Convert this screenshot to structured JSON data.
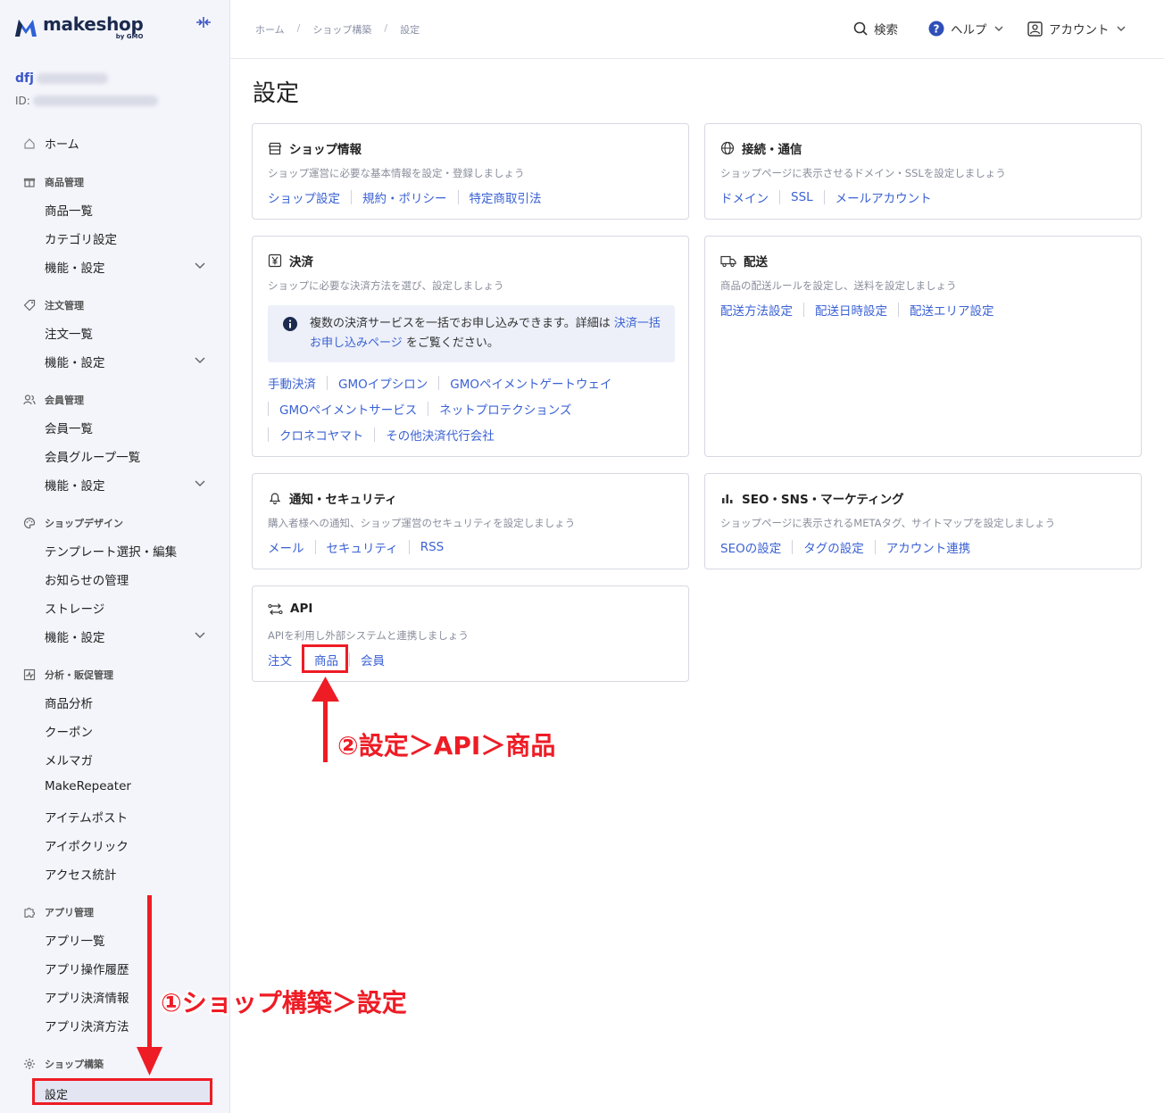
{
  "brand": {
    "name": "makeshop",
    "sub": "by GMO"
  },
  "shop": {
    "name": "dfj",
    "id_label": "ID:"
  },
  "sidebar": {
    "home": "ホーム",
    "products": {
      "title": "商品管理",
      "items": [
        "商品一覧",
        "カテゴリ設定",
        "機能・設定"
      ]
    },
    "orders": {
      "title": "注文管理",
      "items": [
        "注文一覧",
        "機能・設定"
      ]
    },
    "members": {
      "title": "会員管理",
      "items": [
        "会員一覧",
        "会員グループ一覧",
        "機能・設定"
      ]
    },
    "design": {
      "title": "ショップデザイン",
      "items": [
        "テンプレート選択・編集",
        "お知らせの管理",
        "ストレージ",
        "機能・設定"
      ]
    },
    "analytics": {
      "title": "分析・販促管理",
      "items": [
        "商品分析",
        "クーポン",
        "メルマガ",
        "MakeRepeater",
        "アイテムポスト",
        "アイポクリック",
        "アクセス統計"
      ]
    },
    "apps": {
      "title": "アプリ管理",
      "items": [
        "アプリ一覧",
        "アプリ操作履歴",
        "アプリ決済情報",
        "アプリ決済方法"
      ]
    },
    "build": {
      "title": "ショップ構築",
      "items": [
        "設定"
      ]
    }
  },
  "header": {
    "breadcrumb": [
      "ホーム",
      "ショップ構築",
      "設定"
    ],
    "search": "検索",
    "help": "ヘルプ",
    "account": "アカウント"
  },
  "page": {
    "title": "設定"
  },
  "cards": {
    "shop_info": {
      "title": "ショップ情報",
      "desc": "ショップ運営に必要な基本情報を設定・登録しましょう",
      "links": [
        "ショップ設定",
        "規約・ポリシー",
        "特定商取引法"
      ]
    },
    "connect": {
      "title": "接続・通信",
      "desc": "ショップページに表示させるドメイン・SSLを設定しましょう",
      "links": [
        "ドメイン",
        "SSL",
        "メールアカウント"
      ]
    },
    "payment": {
      "title": "決済",
      "desc": "ショップに必要な決済方法を選び、設定しましょう",
      "info_text_1": "複数の決済サービスを一括でお申し込みできます。詳細は",
      "info_link": "決済一括お申し込みページ",
      "info_text_2": "をご覧ください。",
      "links_row1": [
        "手動決済",
        "GMOイプシロン",
        "GMOペイメントゲートウェイ"
      ],
      "links_row2": [
        "GMOペイメントサービス",
        "ネットプロテクションズ"
      ],
      "links_row3": [
        "クロネコヤマト",
        "その他決済代行会社"
      ]
    },
    "shipping": {
      "title": "配送",
      "desc": "商品の配送ルールを設定し、送料を設定しましょう",
      "links": [
        "配送方法設定",
        "配送日時設定",
        "配送エリア設定"
      ]
    },
    "notify": {
      "title": "通知・セキュリティ",
      "desc": "購入者様への通知、ショップ運営のセキュリティを設定しましょう",
      "links": [
        "メール",
        "セキュリティ",
        "RSS"
      ]
    },
    "seo": {
      "title": "SEO・SNS・マーケティング",
      "desc": "ショップページに表示されるMETAタグ、サイトマップを設定しましょう",
      "links": [
        "SEOの設定",
        "タグの設定",
        "アカウント連携"
      ]
    },
    "api": {
      "title": "API",
      "desc": "APIを利用し外部システムと連携しましょう",
      "links": [
        "注文",
        "商品",
        "会員"
      ]
    }
  },
  "annotations": {
    "step1": "①ショップ構築＞設定",
    "step2": "②設定＞API＞商品"
  },
  "colors": {
    "accent": "#3b62d4",
    "annotation": "#ee1c25",
    "sidebar_bg": "#f4f5fb"
  }
}
